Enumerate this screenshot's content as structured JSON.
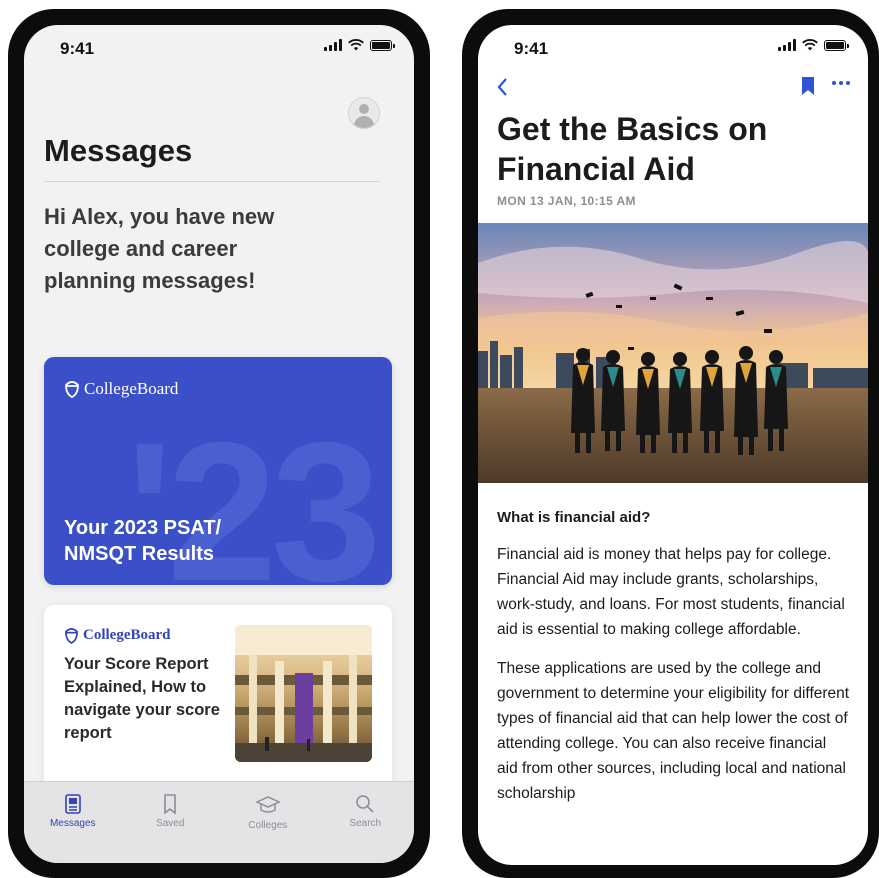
{
  "left_phone": {
    "status": {
      "time": "9:41"
    },
    "page_title": "Messages",
    "greeting": "Hi Alex, you have new college and career planning messages!",
    "psat_card": {
      "brand": "CollegeBoard",
      "big_number": "'23",
      "title": "Your 2023 PSAT/ NMSQT Results",
      "color": "#3b50c8"
    },
    "report_card": {
      "brand": "CollegeBoard",
      "title": "Your Score Report Explained, How to navigate your score report"
    },
    "tabs": [
      {
        "label": "Messages",
        "icon": "messages-icon",
        "active": true
      },
      {
        "label": "Saved",
        "icon": "bookmark-icon",
        "active": false
      },
      {
        "label": "Colleges",
        "icon": "graduation-cap-icon",
        "active": false
      },
      {
        "label": "Search",
        "icon": "search-icon",
        "active": false
      }
    ],
    "accent": "#3344b5"
  },
  "right_phone": {
    "status": {
      "time": "9:41"
    },
    "article_title": "Get the Basics on Financial Aid",
    "date": "MON 13 JAN, 10:15 AM",
    "section_heading": "What is financial aid?",
    "paragraphs": [
      "Financial aid is money that helps pay for college. Financial Aid may include grants, scholarships, work-study, and loans. For most students, financial aid is essential to making college affordable.",
      "These applications are used by the college and government to determine your eligibility for different types of financial aid that can help lower the cost of attending college. You can also receive financial aid from other sources, including local and national scholarship"
    ],
    "accent": "#2f55d4"
  }
}
